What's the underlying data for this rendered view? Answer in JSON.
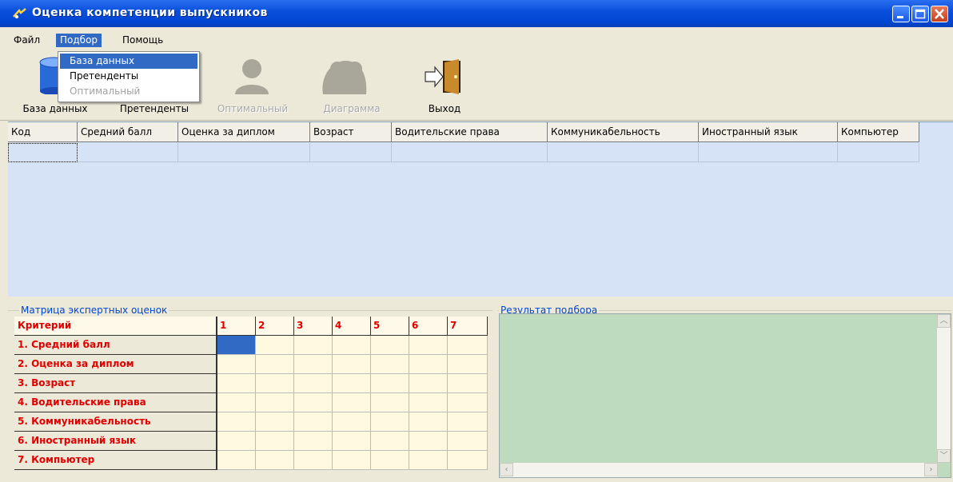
{
  "window": {
    "title": "Оценка компетенции выпускников"
  },
  "menu": {
    "items": [
      "Файл",
      "Подбор",
      "Помощь"
    ]
  },
  "dropdown": {
    "items": [
      "База данных",
      "Претенденты",
      "Оптимальный"
    ]
  },
  "toolbar": {
    "buttons": [
      {
        "label": "База данных",
        "icon": "database-icon"
      },
      {
        "label": "Претенденты",
        "icon": "person-icon"
      },
      {
        "label": "Оптимальный",
        "icon": "person-icon"
      },
      {
        "label": "Диаграмма",
        "icon": "group-icon"
      },
      {
        "label": "Выход",
        "icon": "exit-door-icon"
      }
    ]
  },
  "grid": {
    "columns": [
      "Код",
      "Средний балл",
      "Оценка за диплом",
      "Возраст",
      "Водительские права",
      "Коммуникабельность",
      "Иностранный язык",
      "Компьютер"
    ]
  },
  "matrix": {
    "title": "Матрица экспертных оценок",
    "header": [
      "Критерий",
      "1",
      "2",
      "3",
      "4",
      "5",
      "6",
      "7"
    ],
    "criteria": [
      "1. Средний балл",
      "2. Оценка за диплом",
      "3. Возраст",
      "4. Водительские права",
      "5. Коммуникабельность",
      "6. Иностранный язык",
      "7. Компьютер"
    ]
  },
  "result": {
    "title": "Результат подбора"
  },
  "colors": {
    "title_bar": "#0a50dc",
    "selection": "#316ac5",
    "grid_bg": "#d6e3f7",
    "result_bg": "#bfdbbf",
    "criteria_text": "#e00000"
  }
}
